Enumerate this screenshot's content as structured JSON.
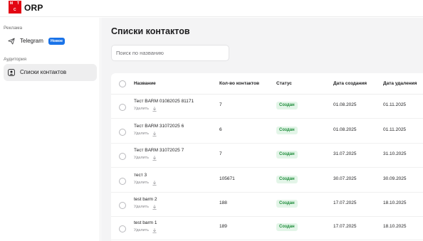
{
  "brand": {
    "logo_letters": [
      "М",
      "Т",
      "С"
    ],
    "name": "ORP",
    "logo_color": "#e30613"
  },
  "sidebar": {
    "sections": [
      {
        "label": "Реклама",
        "items": [
          {
            "label": "Telegram",
            "icon": "send-icon",
            "badge": "Новое",
            "active": false
          }
        ]
      },
      {
        "label": "Аудитория",
        "items": [
          {
            "label": "Списки контактов",
            "icon": "contacts-icon",
            "active": true
          }
        ]
      }
    ]
  },
  "main": {
    "title": "Списки контактов",
    "search": {
      "placeholder": "Поиск по названию",
      "value": ""
    }
  },
  "table": {
    "columns": [
      "Название",
      "Кол-во контактов",
      "Статус",
      "Дата создания",
      "Дата удаления"
    ],
    "delete_label": "Удалить",
    "rows": [
      {
        "name": "Тест BARM 01082025 81171",
        "count": "7",
        "status": "Создан",
        "created": "01.08.2025",
        "deleted": "01.11.2025"
      },
      {
        "name": "Тест BARM 31072025 6",
        "count": "6",
        "status": "Создан",
        "created": "01.08.2025",
        "deleted": "01.11.2025"
      },
      {
        "name": "Тест BARM 31072025 7",
        "count": "7",
        "status": "Создан",
        "created": "31.07.2025",
        "deleted": "31.10.2025"
      },
      {
        "name": "тест 3",
        "count": "105671",
        "status": "Создан",
        "created": "30.07.2025",
        "deleted": "30.09.2025"
      },
      {
        "name": "test barm 2",
        "count": "188",
        "status": "Создан",
        "created": "17.07.2025",
        "deleted": "18.10.2025"
      },
      {
        "name": "test barm 1",
        "count": "189",
        "status": "Создан",
        "created": "17.07.2025",
        "deleted": "18.10.2025"
      }
    ]
  },
  "colors": {
    "accent_badge": "#1a73e8",
    "status_bg": "#e3f5e8",
    "status_text": "#1e8c3a",
    "content_bg": "#f4f4f5"
  }
}
